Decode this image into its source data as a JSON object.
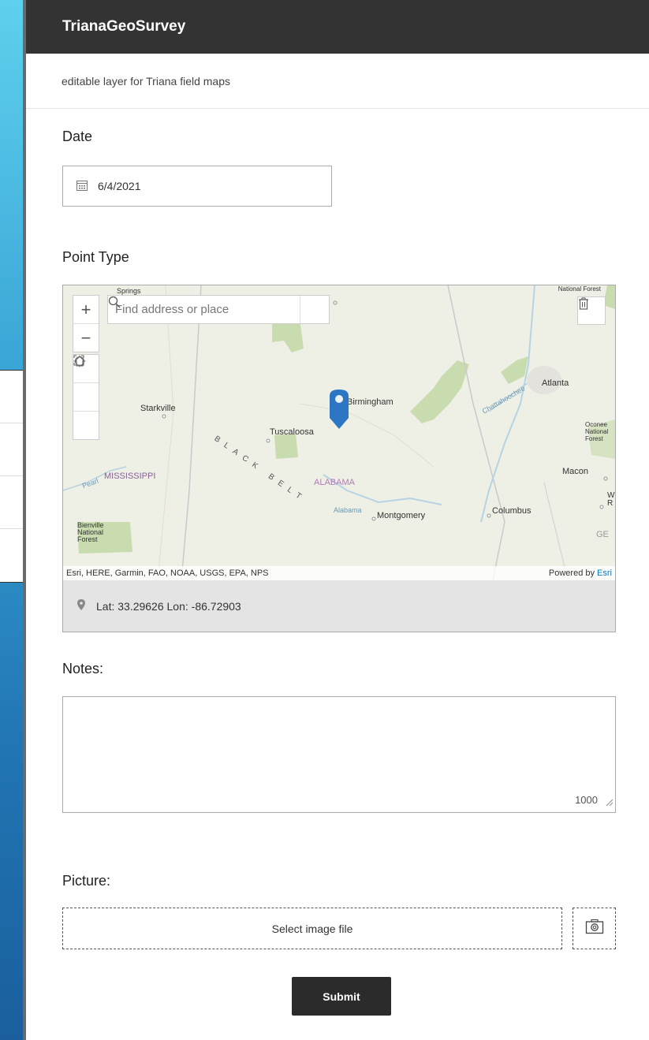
{
  "header": {
    "title": "TrianaGeoSurvey"
  },
  "form": {
    "description": "editable layer for Triana field maps",
    "date_label": "Date",
    "date_value": "6/4/2021",
    "point_type_label": "Point Type",
    "notes_label": "Notes:",
    "notes_counter": "1000",
    "picture_label": "Picture:",
    "select_image_label": "Select image file",
    "submit_label": "Submit"
  },
  "map": {
    "search_placeholder": "Find address or place",
    "attribution": "Esri, HERE, Garmin, FAO, NOAA, USGS, EPA, NPS",
    "powered_by": "Powered by",
    "powered_by_link": "Esri",
    "coords": "Lat: 33.29626  Lon: -86.72903",
    "labels": {
      "springs": "Springs",
      "national_forest_top": "National Forest",
      "atlanta": "Atlanta",
      "starkville": "Starkville",
      "birmingham": "Birmingham",
      "tuscaloosa": "Tuscaloosa",
      "chattahoochee": "Chattahoochee",
      "oconee": "Oconee National Forest",
      "mississippi": "MISSISSIPPI",
      "pearl": "Pearl",
      "black_belt": "BLACK BELT",
      "alabama_state": "ALABAMA",
      "alabama_river": "Alabama",
      "macon": "Macon",
      "montgomery": "Montgomery",
      "columbus": "Columbus",
      "bienville": "Bienville National Forest",
      "ge": "GE",
      "wr": "W R"
    }
  },
  "sidetool": {
    "icons": [
      "building-icon",
      "building-icon",
      "person-icon",
      "person-icon"
    ]
  }
}
